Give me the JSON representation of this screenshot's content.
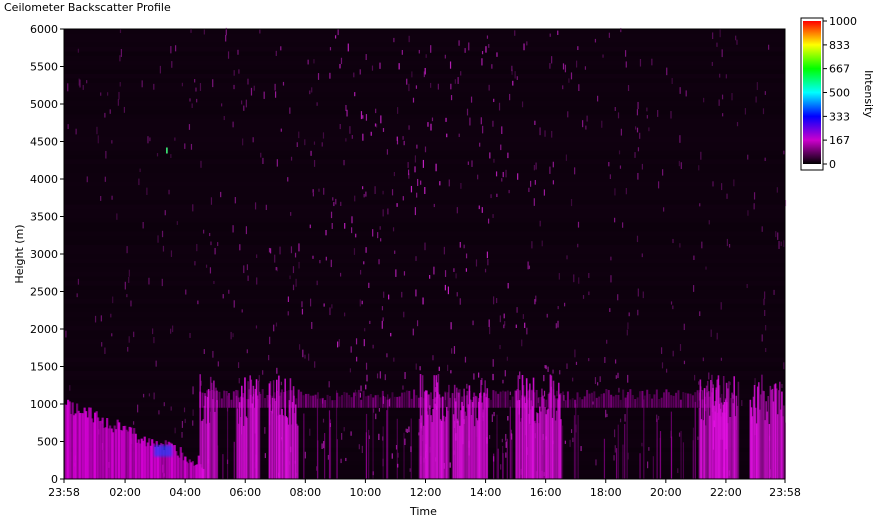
{
  "chart_data": {
    "type": "heatmap",
    "title": "Ceilometer Backscatter Profile",
    "xlabel": "Time",
    "ylabel": "Height (m)",
    "colorbar_label": "Intensity",
    "x_ticks": [
      "23:58",
      "02:00",
      "04:00",
      "06:00",
      "08:00",
      "10:00",
      "12:00",
      "14:00",
      "16:00",
      "18:00",
      "20:00",
      "22:00",
      "23:58"
    ],
    "x_hours": [
      0,
      2.033,
      4.033,
      6.033,
      8.033,
      10.033,
      12.033,
      14.033,
      16.033,
      18.033,
      20.033,
      22.033,
      24
    ],
    "y_ticks": [
      "0",
      "500",
      "1000",
      "1500",
      "2000",
      "2500",
      "3000",
      "3500",
      "4000",
      "4500",
      "5000",
      "5500",
      "6000"
    ],
    "ylim": [
      0,
      6000
    ],
    "xlim_hours": [
      0,
      24
    ],
    "colorbar_ticks": [
      "0",
      "167",
      "333",
      "500",
      "667",
      "833",
      "1000"
    ],
    "colorbar_range": [
      0,
      1000
    ],
    "colormap": [
      "#000000",
      "#cc00cc",
      "#0000ff",
      "#00ffff",
      "#00ff00",
      "#ffff00",
      "#ff0000"
    ],
    "background_color": "#0a000a",
    "features": {
      "boundary_layer_top_m": 1200,
      "plumes_hours": [
        4.8,
        6.1,
        7.3,
        12.3,
        13.5,
        15.3,
        16.0,
        21.6,
        22.0,
        23.4
      ],
      "morning_layer": {
        "start_hour": 0,
        "end_hour": 4.6,
        "start_height_m": 1000,
        "end_height_m": 200
      }
    }
  }
}
